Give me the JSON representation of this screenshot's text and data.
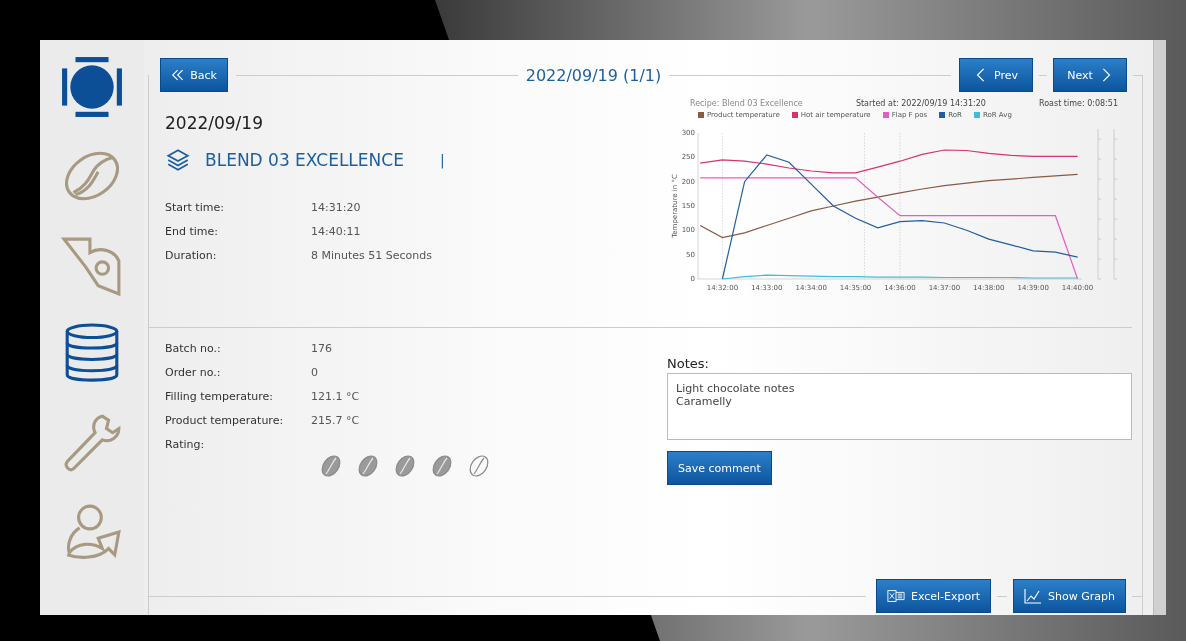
{
  "sidebar": {
    "items": [
      {
        "selected": false
      },
      {
        "selected": false
      },
      {
        "selected": true
      },
      {
        "selected": false
      },
      {
        "selected": false
      }
    ]
  },
  "header": {
    "back": "Back",
    "title": "2022/09/19 (1/1)",
    "prev": "Prev",
    "next": "Next"
  },
  "roast": {
    "date": "2022/09/19",
    "recipe": "BLEND 03 EXCELLENCE",
    "marker": "|",
    "times": [
      {
        "label": "Start time:",
        "value": "14:31:20"
      },
      {
        "label": "End time:",
        "value": "14:40:11"
      },
      {
        "label": "Duration:",
        "value": "8 Minutes 51 Seconds"
      }
    ]
  },
  "chart": {
    "recipe": "Recipe: Blend 03 Excellence",
    "started": "Started at: 2022/09/19 14:31:20",
    "roast_time": "Roast time: 0:08:51",
    "chart_data": {
      "type": "line",
      "legend": "top",
      "ylabel": "Temperature in °C",
      "categories": [
        null,
        "14:32:00",
        null,
        "14:33:00",
        null,
        "14:34:00",
        null,
        "14:35:00",
        null,
        "14:36:00",
        null,
        "14:37:00",
        null,
        "14:38:00",
        null,
        "14:39:00",
        null,
        "14:40:00"
      ],
      "ylim": [
        0,
        300
      ],
      "yticks": [
        0,
        50,
        100,
        150,
        200,
        250,
        300
      ],
      "series": [
        {
          "name": "Product temperature",
          "color": "#8a5a44",
          "values": [
            110,
            85,
            95,
            110,
            125,
            140,
            150,
            160,
            168,
            177,
            185,
            192,
            197,
            202,
            205,
            209,
            212,
            215
          ]
        },
        {
          "name": "Hot air temperature",
          "color": "#d6336c",
          "values": [
            238,
            245,
            242,
            236,
            228,
            222,
            218,
            218,
            230,
            242,
            256,
            265,
            264,
            258,
            254,
            252,
            252,
            252
          ]
        },
        {
          "name": "Flap F pos",
          "color": "#e060c0",
          "values": [
            208,
            208,
            208,
            208,
            208,
            208,
            208,
            208,
            168,
            130,
            130,
            130,
            130,
            130,
            130,
            130,
            130,
            0
          ]
        },
        {
          "name": "RoR",
          "color": "#1f5fa0",
          "values": [
            null,
            0,
            200,
            255,
            240,
            195,
            150,
            125,
            105,
            118,
            120,
            115,
            100,
            82,
            70,
            58,
            55,
            45
          ]
        },
        {
          "name": "RoR Avg",
          "color": "#3cc0d8",
          "values": [
            null,
            0,
            5,
            8,
            7,
            6,
            5,
            5,
            4,
            4,
            4,
            3,
            3,
            3,
            3,
            2,
            2,
            2
          ]
        }
      ]
    }
  },
  "details": [
    {
      "label": "Batch no.:",
      "value": "176"
    },
    {
      "label": "Order no.:",
      "value": "0"
    },
    {
      "label": "Filling temperature:",
      "value": "121.1 °C"
    },
    {
      "label": "Product temperature:",
      "value": "215.7 °C"
    }
  ],
  "rating": {
    "label": "Rating:",
    "stars": 4
  },
  "notes": {
    "label": "Notes:",
    "value": "Light chocolate notes\nCaramelly",
    "save": "Save comment"
  },
  "footer": {
    "excel": "Excel-Export",
    "graph": "Show Graph"
  }
}
